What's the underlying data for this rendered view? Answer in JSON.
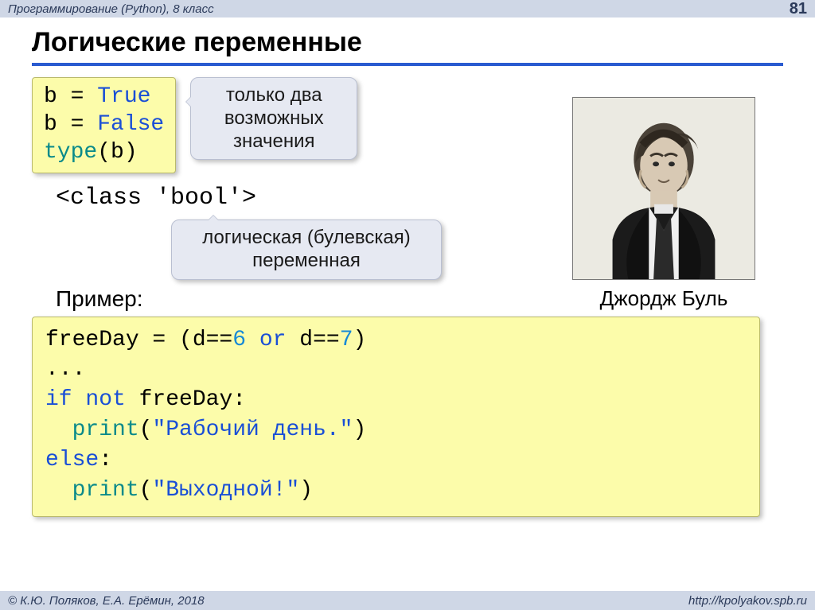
{
  "header": {
    "course": "Программирование (Python), 8 класс",
    "page": "81"
  },
  "title": "Логические переменные",
  "code1": {
    "l1_a": "b = ",
    "l1_b": "True",
    "l2_a": "b = ",
    "l2_b": "False",
    "l3_a": "type",
    "l3_b": "(b)"
  },
  "callout1": {
    "l1": "только два",
    "l2": "возможных",
    "l3": "значения"
  },
  "output": "<class 'bool'>",
  "callout2": {
    "l1": "логическая (булевская)",
    "l2": "переменная"
  },
  "portrait_caption": "Джордж Буль",
  "example_label": "Пример:",
  "code2": {
    "l1_a": "freeDay = (d==",
    "l1_b": "6",
    "l1_c": " or",
    "l1_d": " d==",
    "l1_e": "7",
    "l1_f": ")",
    "l2": "...",
    "l3_a": "if not",
    "l3_b": " freeDay:",
    "l4_a": "  print",
    "l4_b": "(",
    "l4_c": "\"Рабочий день.\"",
    "l4_d": ")",
    "l5_a": "else",
    "l5_b": ":",
    "l6_a": "  print",
    "l6_b": "(",
    "l6_c": "\"Выходной!\"",
    "l6_d": ")"
  },
  "footer": {
    "copyright": "© К.Ю. Поляков, Е.А. Ерёмин, 2018",
    "url": "http://kpolyakov.spb.ru"
  }
}
